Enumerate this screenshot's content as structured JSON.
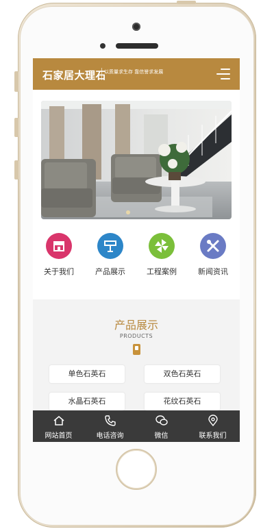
{
  "header": {
    "title": "石家居大理石",
    "slogan": "以质量求生存 靠信誉求发展",
    "menu_icon": "hamburger-menu-icon",
    "background": "#b8893f"
  },
  "nav": [
    {
      "label": "关于我们",
      "icon": "shop-icon",
      "color": "#d9356b"
    },
    {
      "label": "产品展示",
      "icon": "product-icon",
      "color": "#2d86c8"
    },
    {
      "label": "工程案例",
      "icon": "pinwheel-icon",
      "color": "#7bbf3a"
    },
    {
      "label": "新闻资讯",
      "icon": "tools-icon",
      "color": "#6a7bc4"
    }
  ],
  "products": {
    "title": "产品展示",
    "subtitle": "PRODUCTS",
    "categories": [
      "单色石英石",
      "双色石英石",
      "水晶石英石",
      "花纹石英石"
    ]
  },
  "bottom_bar": [
    {
      "label": "网站首页",
      "icon": "home-icon"
    },
    {
      "label": "电话咨询",
      "icon": "phone-icon"
    },
    {
      "label": "微信",
      "icon": "wechat-icon"
    },
    {
      "label": "联系我们",
      "icon": "location-pin-icon"
    }
  ]
}
